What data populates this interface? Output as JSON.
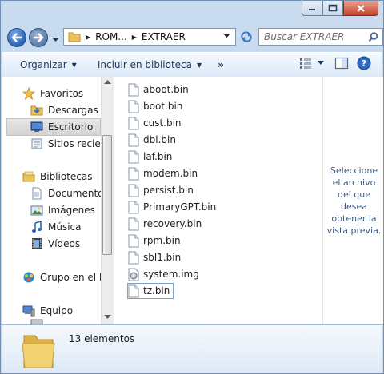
{
  "address": {
    "crumbs": [
      "ROM...",
      "EXTRAER"
    ]
  },
  "search": {
    "placeholder": "Buscar EXTRAER"
  },
  "toolbar": {
    "organize": "Organizar",
    "include": "Incluir en biblioteca",
    "more": "»"
  },
  "nav": {
    "favorites": "Favoritos",
    "downloads": "Descargas",
    "desktop": "Escritorio",
    "recent": "Sitios recient",
    "libraries": "Bibliotecas",
    "documents": "Documentos",
    "images": "Imágenes",
    "music": "Música",
    "videos": "Vídeos",
    "homegroup": "Grupo en el ho",
    "computer": "Equipo"
  },
  "files": [
    "aboot.bin",
    "boot.bin",
    "cust.bin",
    "dbi.bin",
    "laf.bin",
    "modem.bin",
    "persist.bin",
    "PrimaryGPT.bin",
    "recovery.bin",
    "rpm.bin",
    "sbl1.bin",
    "system.img",
    "tz.bin"
  ],
  "preview_text": "Seleccione el archivo del que desea obtener la vista previa.",
  "details": {
    "count": "13 elementos"
  },
  "icons": {
    "favorites": "star-icon",
    "downloads": "downloads-folder-icon",
    "desktop": "desktop-icon",
    "recent": "recent-places-icon",
    "libraries": "library-icon",
    "documents": "documents-icon",
    "images": "images-icon",
    "music": "music-icon",
    "videos": "videos-icon",
    "homegroup": "homegroup-icon",
    "computer": "computer-icon"
  },
  "colors": {
    "chrome": "#c9dcef",
    "toolbar_text": "#1e395b",
    "preview_text": "#3d5a80",
    "close_button": "#c6432a"
  }
}
